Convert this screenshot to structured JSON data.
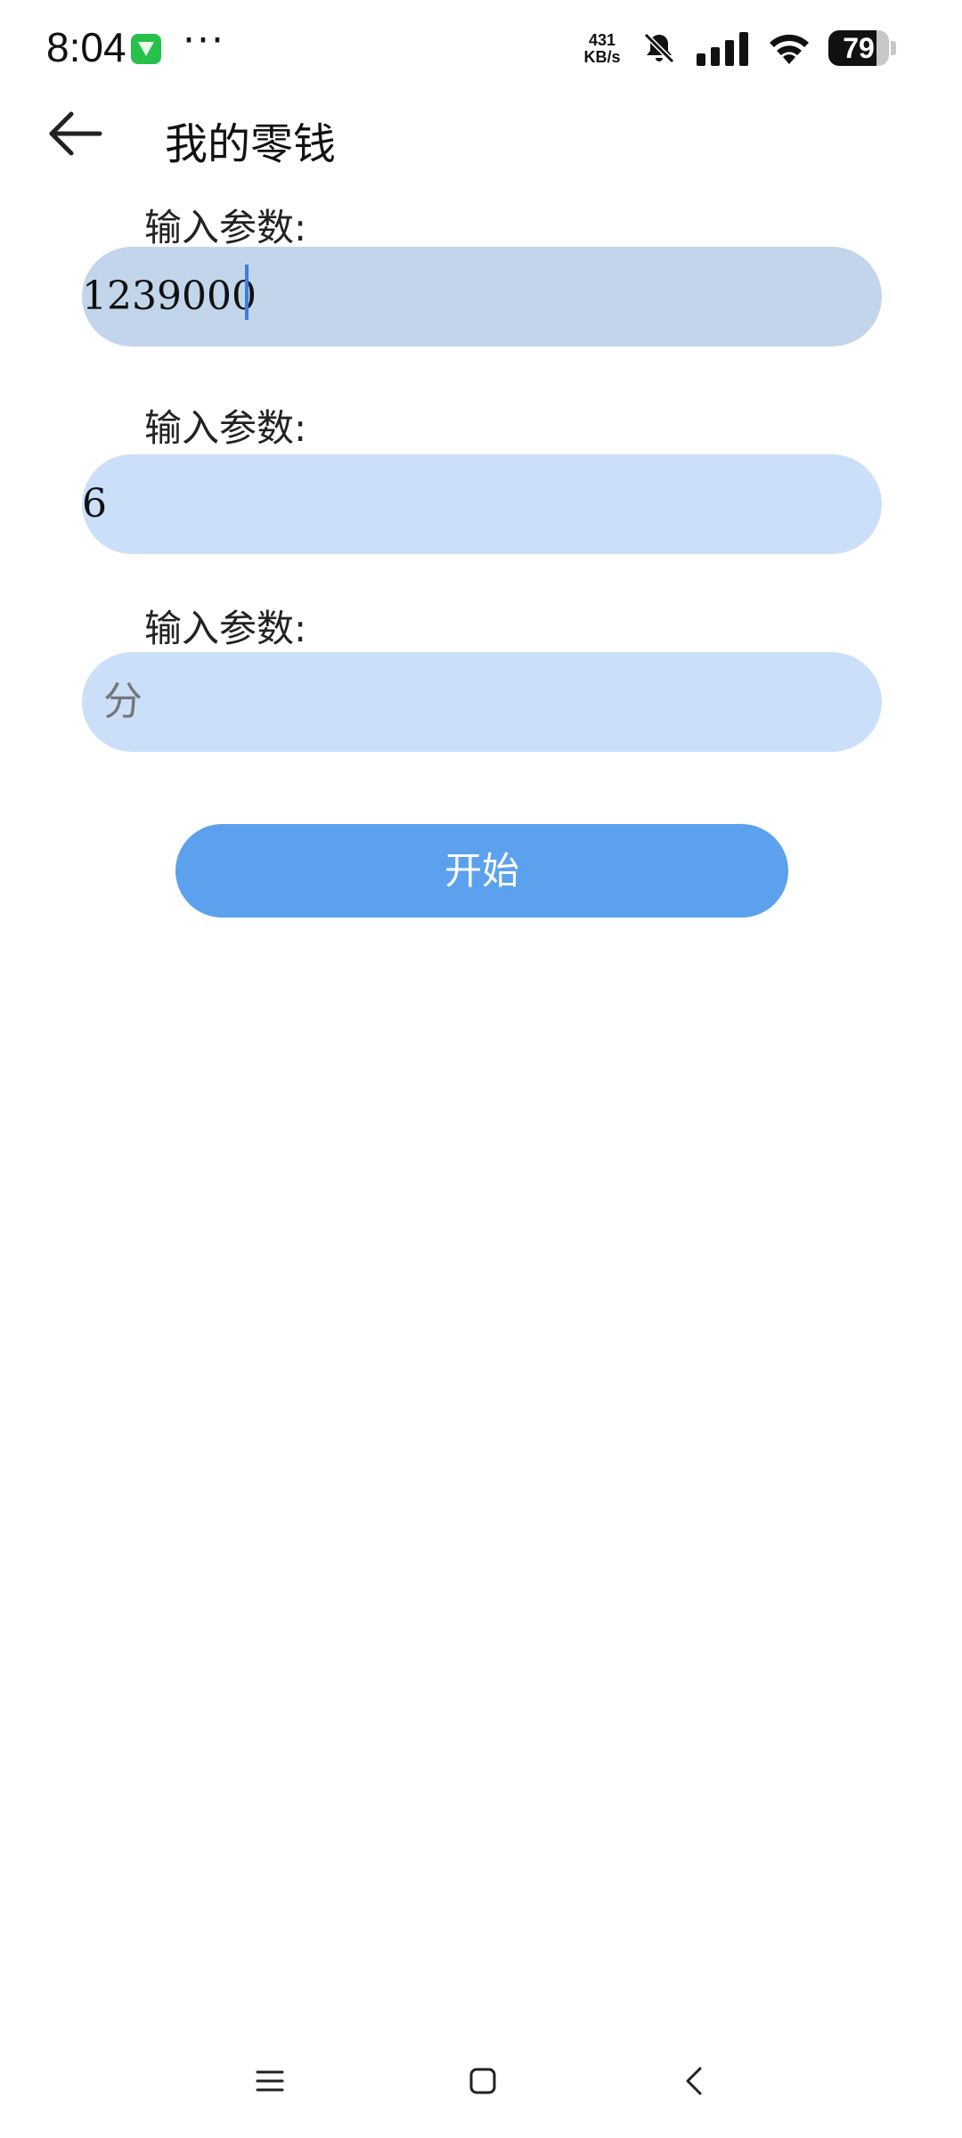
{
  "status_bar": {
    "time": "8:04",
    "app_badge_icon": "green-app-notification-icon",
    "more": "···",
    "net_speed_value": "431",
    "net_speed_unit": "KB/s",
    "battery_level": "79",
    "icons": [
      "bell-off-icon",
      "signal-icon",
      "wifi-icon",
      "battery-icon"
    ]
  },
  "header": {
    "back_icon": "arrow-left-icon",
    "title": "我的零钱"
  },
  "form": {
    "fields": [
      {
        "label": "输入参数:",
        "value": "1239000",
        "placeholder": "",
        "focused": true
      },
      {
        "label": "输入参数:",
        "value": "6",
        "placeholder": "",
        "focused": false
      },
      {
        "label": "输入参数:",
        "value": "",
        "placeholder": "分",
        "focused": false
      }
    ],
    "submit_label": "开始"
  },
  "nav_bar": {
    "icons": [
      "menu-icon",
      "home-icon",
      "back-icon"
    ]
  },
  "colors": {
    "field_bg": "#cbe0f8",
    "field_focused_bg": "#c2d5eb",
    "button_bg": "#5ba1ed",
    "caret": "#3a7ee0"
  }
}
